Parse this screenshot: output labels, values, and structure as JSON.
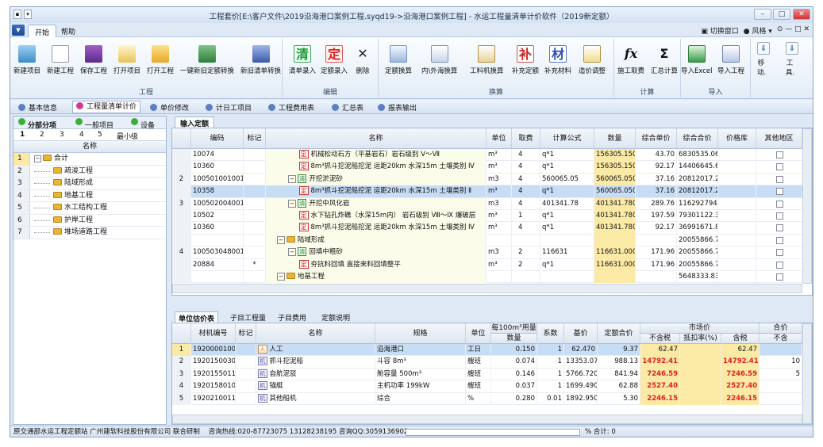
{
  "window": {
    "title": "工程套价[E:\\客户文件\\2019沿海港口案例工程.syqd19->沿海港口案例工程] - 水运工程量清单计价软件（2019新定额）"
  },
  "menu": {
    "tabs": [
      "开始",
      "帮助"
    ],
    "right": [
      "切换窗口",
      "风格"
    ]
  },
  "ribbon": {
    "groups": [
      {
        "label": "工程",
        "buttons": [
          "新建项目",
          "新建工程",
          "保存工程",
          "打开项目",
          "打开工程",
          "一键新旧定额转换",
          "新旧清单转换"
        ]
      },
      {
        "label": "编辑",
        "buttons": [
          "清单录入",
          "定额录入",
          "删除"
        ]
      },
      {
        "label": "换算",
        "buttons": [
          "定额换算",
          "内\\外海换算",
          "工料机换算",
          "补充定额",
          "补充材料",
          "造价调整"
        ]
      },
      {
        "label": "计算",
        "buttons": [
          "施工取费",
          "汇总计算"
        ]
      },
      {
        "label": "导入",
        "buttons": [
          "导入Excel",
          "导入工程"
        ]
      },
      {
        "label": "",
        "buttons": [
          "移动.",
          "工具."
        ]
      }
    ],
    "icon_chars": {
      "qing": "清",
      "ding": "定",
      "bu": "补",
      "cai": "材",
      "fx": "fx",
      "sum": "Σ"
    }
  },
  "nav": [
    "基本信息",
    "工程量清单计价",
    "单价修改",
    "计日工项目",
    "工程费用表",
    "汇总表",
    "报表输出"
  ],
  "left": {
    "tabs": [
      "分部分项",
      "一般项目",
      "设备"
    ],
    "levels": [
      "1",
      "2",
      "3",
      "4",
      "5",
      "最小级"
    ],
    "header": "名称",
    "rows": [
      {
        "n": "1",
        "label": "合计"
      },
      {
        "n": "2",
        "label": "疏浚工程"
      },
      {
        "n": "3",
        "label": "陆域形成"
      },
      {
        "n": "4",
        "label": "地基工程"
      },
      {
        "n": "5",
        "label": "水工结构工程"
      },
      {
        "n": "6",
        "label": "护岸工程"
      },
      {
        "n": "7",
        "label": "堆场道路工程"
      }
    ]
  },
  "top": {
    "tab": "输入定额",
    "headers": [
      "编码",
      "标记",
      "名称",
      "单位",
      "取费",
      "计算公式",
      "数量",
      "综合单价",
      "综合合价",
      "价格库",
      "其他地区"
    ],
    "rows": [
      {
        "n": "",
        "code": "10074",
        "mark": "",
        "type": "ding",
        "name": "机械松动石方（平基岩石）岩石级别 Ⅴ～Ⅶ",
        "unit": "m³",
        "fee": "4",
        "formula": "q*1",
        "qty": "156305.150",
        "price": "43.70",
        "total": "6830535.06"
      },
      {
        "n": "",
        "code": "10360",
        "mark": "",
        "type": "ding",
        "name": "8m³抓斗挖泥船挖泥 运距20km 水深15m 土壤类别 Ⅳ",
        "unit": "m³",
        "fee": "4",
        "formula": "q*1",
        "qty": "156305.150",
        "price": "92.17",
        "total": "14406645.68"
      },
      {
        "n": "2",
        "code": "100501001001",
        "mark": "",
        "type": "qing",
        "name": "开挖淤泥砂",
        "unit": "m3",
        "fee": "4",
        "formula": "560065.05",
        "qty": "560065.050",
        "price": "37.16",
        "total": "20812017.26"
      },
      {
        "n": "",
        "code": "10358",
        "mark": "",
        "type": "ding",
        "name": "8m³抓斗挖泥船挖泥 运距20km 水深15m 土壤类别 Ⅱ",
        "unit": "m³",
        "fee": "4",
        "formula": "q*1",
        "qty": "560065.050",
        "price": "37.16",
        "total": "20812017.26"
      },
      {
        "n": "3",
        "code": "100502004001",
        "mark": "",
        "type": "qing",
        "name": "开挖中风化岩",
        "unit": "m3",
        "fee": "4",
        "formula": "401341.78",
        "qty": "401341.780",
        "price": "289.76",
        "total": "116292794.17"
      },
      {
        "n": "",
        "code": "10502",
        "mark": "",
        "type": "ding",
        "name": "水下钻孔炸礁（水深15m内） 岩石级别 Ⅷ～Ⅸ 爆破层",
        "unit": "m³",
        "fee": "1",
        "formula": "q*1",
        "qty": "401341.780",
        "price": "197.59",
        "total": "79301122.31"
      },
      {
        "n": "",
        "code": "10360",
        "mark": "",
        "type": "ding",
        "name": "8m³抓斗挖泥船挖泥 运距20km 水深15m 土壤类别 Ⅳ",
        "unit": "m³",
        "fee": "4",
        "formula": "q*1",
        "qty": "401341.780",
        "price": "92.17",
        "total": "36991671.86"
      },
      {
        "n": "",
        "code": "",
        "mark": "",
        "type": "fold",
        "name": "陆域形成",
        "unit": "",
        "fee": "",
        "formula": "",
        "qty": "",
        "price": "",
        "total": "20055866.76"
      },
      {
        "n": "4",
        "code": "100503048001",
        "mark": "",
        "type": "qing",
        "name": "回填中粗砂",
        "unit": "m3",
        "fee": "2",
        "formula": "116631",
        "qty": "116631.000",
        "price": "171.96",
        "total": "20055866.76"
      },
      {
        "n": "",
        "code": "20884",
        "mark": "*",
        "type": "ding",
        "name": "夯抗料回填 直接来料回填整平",
        "unit": "m³",
        "fee": "2",
        "formula": "q*1",
        "qty": "116631.000",
        "price": "171.96",
        "total": "20055866.76"
      },
      {
        "n": "",
        "code": "",
        "mark": "",
        "type": "fold",
        "name": "地基工程",
        "unit": "",
        "fee": "",
        "formula": "",
        "qty": "",
        "price": "",
        "total": "5648333.83"
      }
    ]
  },
  "bottom": {
    "tabs": [
      "单位估价表",
      "子目工程量",
      "子目费用",
      "定额说明"
    ],
    "headers": [
      "材机编号",
      "标记",
      "名称",
      "规格",
      "单位",
      "每100m³用量",
      "系数",
      "基价",
      "定额合价",
      "市场价",
      "合价"
    ],
    "subheaders": [
      "数量",
      "不含税",
      "抵扣率(%)",
      "含税",
      "不含"
    ],
    "rows": [
      {
        "n": "1",
        "code": "1920000100",
        "mark": "",
        "tag": "人",
        "name": "人工",
        "spec": "沿海港口",
        "unit": "工日",
        "qty": "0.150",
        "coef": "1",
        "base": "62.470",
        "dtotal": "9.37",
        "mp": "62.47",
        "rate": "",
        "tax": "62.47",
        "h": ""
      },
      {
        "n": "2",
        "code": "1920150030800",
        "mark": "",
        "tag": "机",
        "name": "抓斗挖泥船",
        "spec": "斗容 8m³",
        "unit": "艘班",
        "qty": "0.074",
        "coef": "1",
        "base": "13353.070",
        "dtotal": "988.13",
        "mp": "14792.41",
        "rate": "",
        "tax": "14792.41",
        "h": "10"
      },
      {
        "n": "3",
        "code": "1920155011100",
        "mark": "",
        "tag": "机",
        "name": "自航泥驳",
        "spec": "舱容量 500m³",
        "unit": "艘班",
        "qty": "0.146",
        "coef": "1",
        "base": "5766.720",
        "dtotal": "841.94",
        "mp": "7246.59",
        "rate": "",
        "tax": "7246.59",
        "h": "5"
      },
      {
        "n": "4",
        "code": "1920158010700",
        "mark": "",
        "tag": "机",
        "name": "锚艇",
        "spec": "主机功率 199kW",
        "unit": "艘班",
        "qty": "0.037",
        "coef": "1",
        "base": "1699.490",
        "dtotal": "62.88",
        "mp": "2527.40",
        "rate": "",
        "tax": "2527.40",
        "h": ""
      },
      {
        "n": "5",
        "code": "1920210011400",
        "mark": "",
        "tag": "机",
        "name": "其他船机",
        "spec": "综合",
        "unit": "%",
        "qty": "0.280",
        "coef": "0.01",
        "base": "1892.950",
        "dtotal": "5.30",
        "mp": "2246.15",
        "rate": "",
        "tax": "2246.15",
        "h": ""
      }
    ]
  },
  "status": {
    "org": "原交通部水运工程定额站 广州建软科技股份有限公司 联合研制",
    "hotline": "咨询热线:020-87723075 13128238195 咨询QQ:3059136902",
    "total": "% 合计: 0"
  },
  "colors": {
    "accent": "#3a6fc0",
    "highlight": "#fbe9a6",
    "selected": "#c7dcf5",
    "red": "#d22"
  }
}
